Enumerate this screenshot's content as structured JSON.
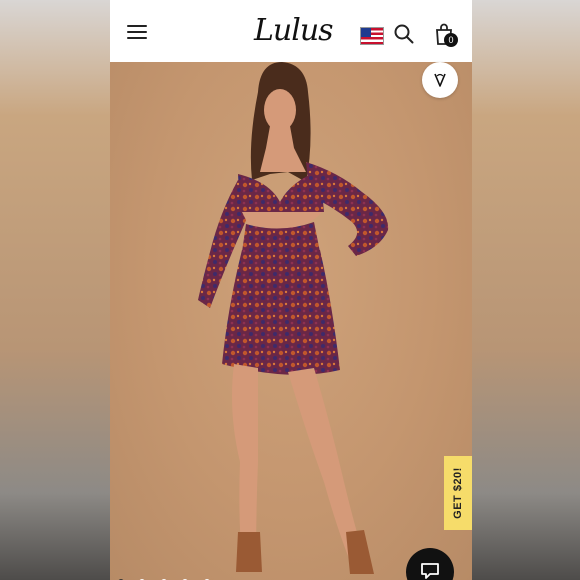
{
  "header": {
    "logo_text": "Lulus",
    "cart_count": "0",
    "icons": [
      "menu-icon",
      "us-flag-icon",
      "search-icon",
      "shopping-bag-icon"
    ]
  },
  "product": {
    "image_alt": "Model wearing a long-sleeve floral print mini dress with cutout",
    "dress_colors": [
      "#6a2747",
      "#c1572c",
      "#3e2a6a"
    ],
    "wishlist_icon": "heart-icon"
  },
  "promo": {
    "label": "GET $20!"
  },
  "chat": {
    "icon": "chat-bubble-icon"
  },
  "carousel": {
    "count": 5,
    "active_index": 0
  },
  "colors": {
    "backdrop": "#c4966f",
    "promo_bg": "#f6dc6a",
    "accent_dark": "#111111"
  }
}
